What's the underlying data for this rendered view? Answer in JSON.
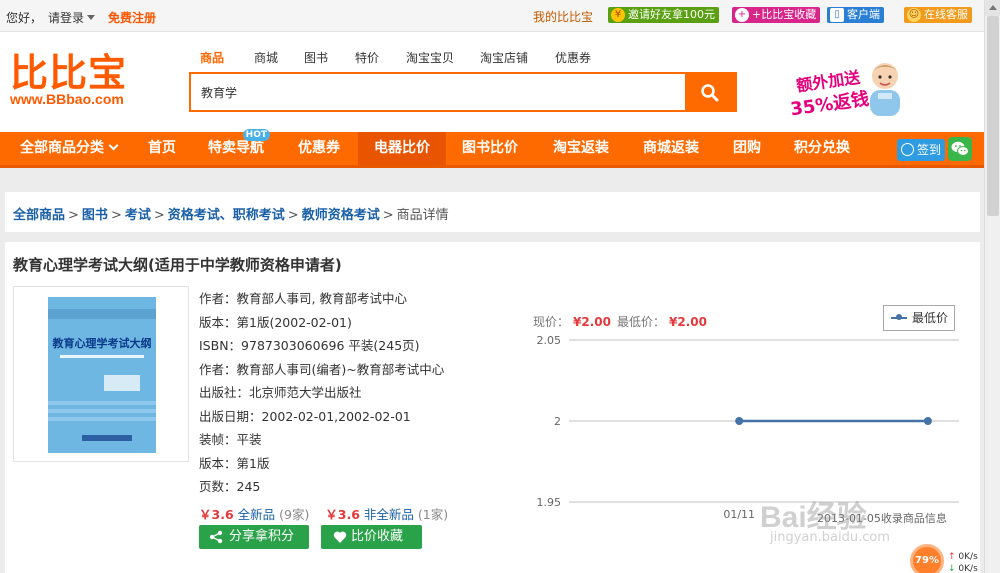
{
  "topbar": {
    "hello": "您好，",
    "login": "请登录",
    "register": "免费注册",
    "my_bbb": "我的比比宝",
    "invite": "邀请好友拿100元",
    "add_favorite": "+比比宝收藏",
    "client": "客户端",
    "service": "在线客服"
  },
  "logo": {
    "name": "比比宝",
    "url": "www.BBbao.com"
  },
  "search": {
    "tabs": [
      "商品",
      "商城",
      "图书",
      "特价",
      "淘宝宝贝",
      "淘宝店铺",
      "优惠券"
    ],
    "active_tab": "商品",
    "value": "教育学"
  },
  "promo": {
    "line1": "额外加送",
    "line2": "35%返钱"
  },
  "nav": {
    "all_categories": "全部商品分类",
    "items": [
      "首页",
      "特卖导航",
      "优惠券",
      "电器比价",
      "图书比价",
      "淘宝返装",
      "商城返装",
      "团购",
      "积分兑换"
    ],
    "hot_badge": "HOT",
    "active": "电器比价",
    "sign_in": "签到"
  },
  "breadcrumb": {
    "links": [
      "全部商品",
      "图书",
      "考试",
      "资格考试、职称考试",
      "教师资格考试"
    ],
    "current": "商品详情",
    "separator": ">"
  },
  "product": {
    "title": "教育心理学考试大纲(适用于中学教师资格申请者)",
    "cover_title": "教育心理学考试大纲",
    "info": [
      "作者：教育部人事司, 教育部考试中心",
      "版本：第1版(2002-02-01)",
      "ISBN：9787303060696   平装(245页)",
      "作者：教育部人事司(编者)~教育部考试中心",
      "出版社：北京师范大学出版社",
      "出版日期：2002-02-01,2002-02-01",
      "装帧：平装",
      "版本：第1版",
      "页数：245"
    ],
    "prices": [
      {
        "price": "￥3.6",
        "type": "全新品",
        "count": "(9家)"
      },
      {
        "price": "￥3.6",
        "type": "非全新品",
        "count": "(1家)"
      }
    ],
    "share_button": "分享拿积分",
    "favorite_button": "比价收藏"
  },
  "price_chart": {
    "current_label": "现价：",
    "current_value": "¥2.00",
    "lowest_label": "最低价：",
    "lowest_value": "¥2.00",
    "note": "2013-01-05收录商品信息"
  },
  "chart_data": {
    "type": "line",
    "x": [
      "",
      "01/11",
      ""
    ],
    "series": [
      {
        "name": "最低价",
        "values": [
          2,
          2
        ]
      }
    ],
    "point_positions": [
      0.46,
      0.97
    ],
    "y_ticks": [
      "2.05",
      "2",
      "1.95"
    ],
    "ylim": [
      1.95,
      2.05
    ],
    "legend_position": "top-right",
    "grid": true,
    "colors": {
      "line": "#4572a7",
      "grid": "#c0c0c0"
    }
  },
  "watermark": {
    "logo": "Bai经验",
    "url": "jingyan.baidu.com"
  },
  "speed": {
    "percent": "79%",
    "up": "0K/s",
    "down": "0K/s"
  },
  "colors": {
    "brand": "#ff6a00",
    "price": "#e4393c",
    "link": "#1a60a8",
    "button": "#2aa24a"
  }
}
